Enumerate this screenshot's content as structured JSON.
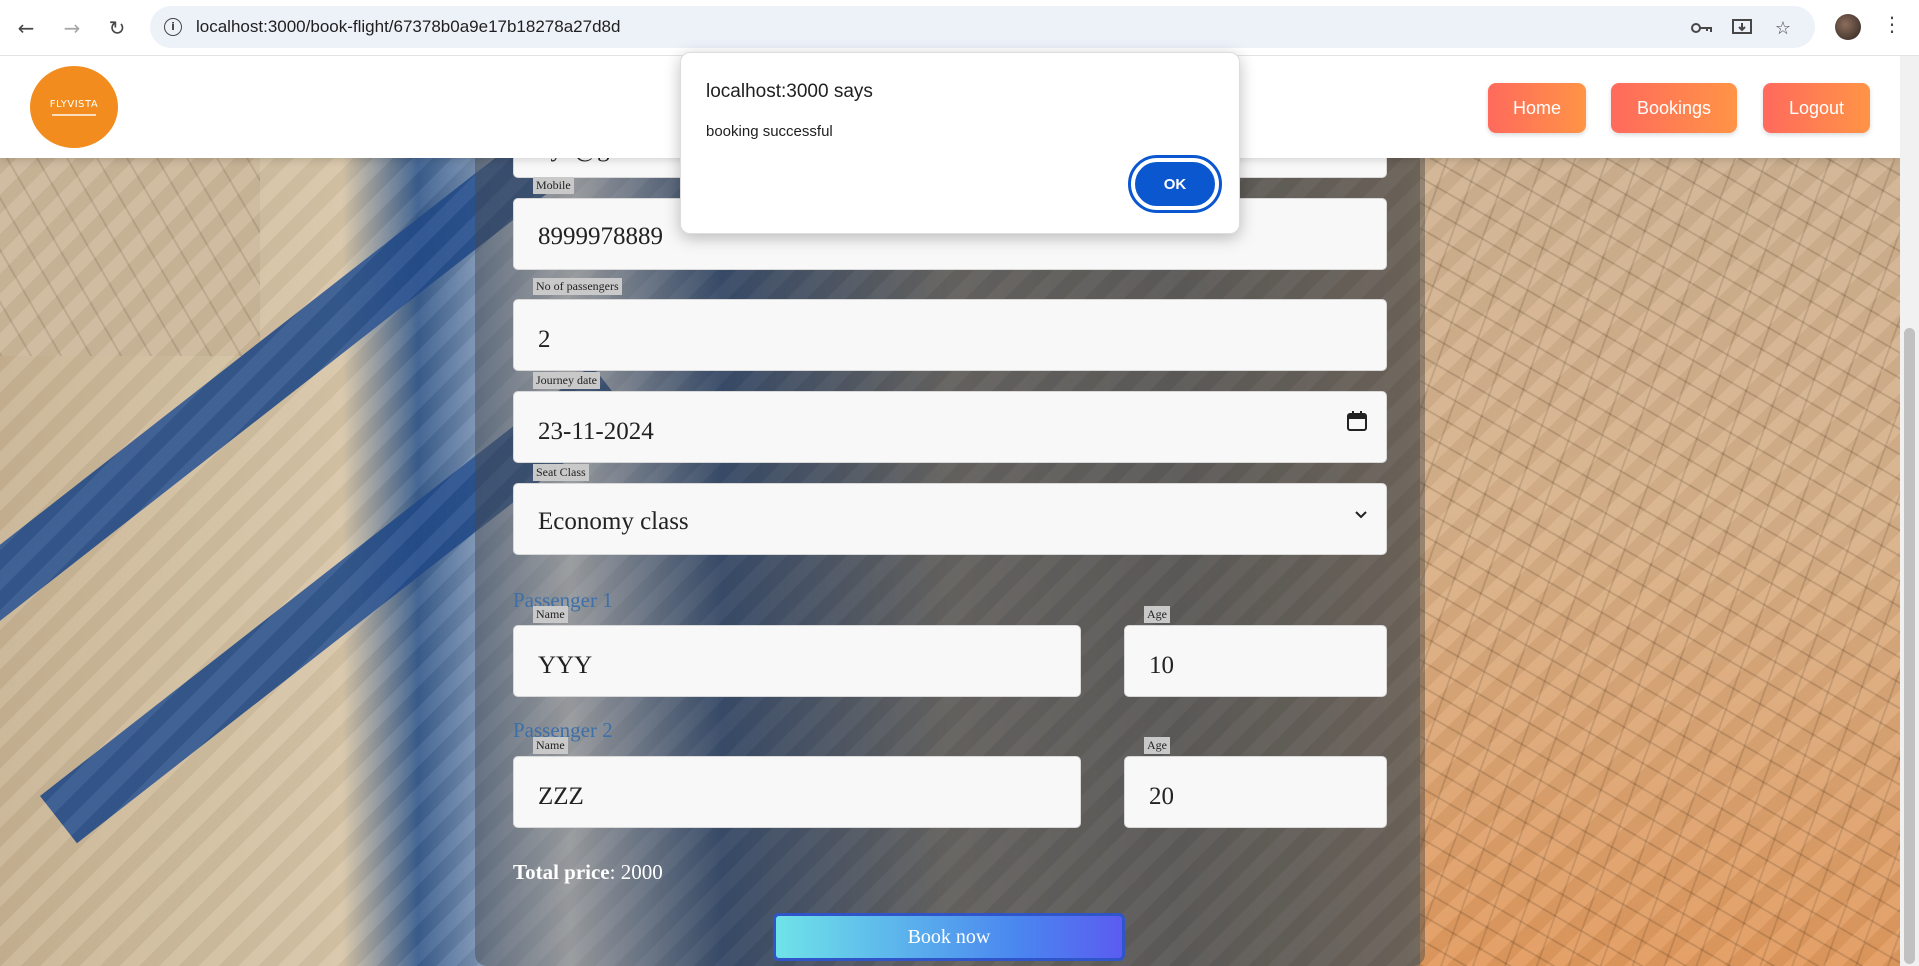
{
  "browser": {
    "url": "localhost:3000/book-flight/67378b0a9e17b18278a27d8d"
  },
  "header": {
    "logo_text": "FLYVISTA",
    "nav": {
      "home": "Home",
      "bookings": "Bookings",
      "logout": "Logout"
    }
  },
  "form": {
    "email_partial": "xyz@gmail.co",
    "mobile": {
      "label": "Mobile",
      "value": "8999978889"
    },
    "passengers": {
      "label": "No of passengers",
      "value": "2"
    },
    "journey_date": {
      "label": "Journey date",
      "value": "23-11-2024"
    },
    "seat_class": {
      "label": "Seat Class",
      "value": "Economy class"
    },
    "passenger_1": {
      "heading": "Passenger 1",
      "name_label": "Name",
      "name_value": "YYY",
      "age_label": "Age",
      "age_value": "10"
    },
    "passenger_2": {
      "heading": "Passenger 2",
      "name_label": "Name",
      "name_value": "ZZZ",
      "age_label": "Age",
      "age_value": "20"
    },
    "total_price_label": "Total price",
    "total_price_value": ": 2000",
    "book_button": "Book now"
  },
  "alert": {
    "title": "localhost:3000 says",
    "message": "booking successful",
    "ok": "OK"
  },
  "colors": {
    "accent": "#0b57d0",
    "nav_button_start": "#ff6a5c",
    "nav_button_end": "#ff9446",
    "logo": "#f28c1e"
  }
}
